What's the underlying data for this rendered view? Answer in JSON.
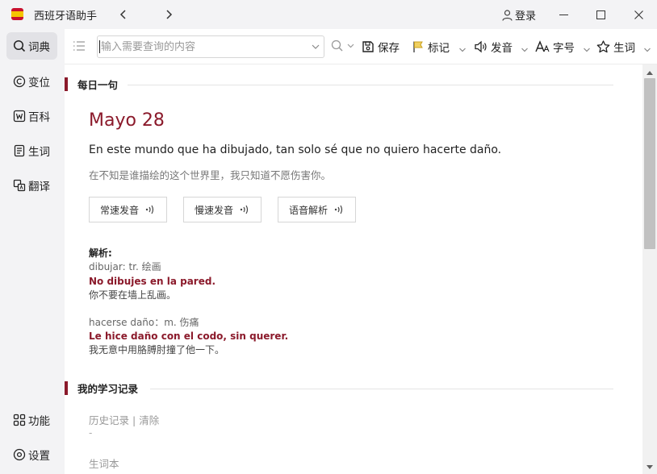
{
  "app": {
    "title": "西班牙语助手",
    "login_label": "登录",
    "icons": [
      "spain-flag-icon",
      "chevron-left-icon",
      "chevron-right-icon",
      "user-icon",
      "minimize-icon",
      "maximize-icon",
      "close-icon"
    ]
  },
  "sidebar": {
    "top_items": [
      {
        "label": "词典",
        "icon": "search-icon",
        "active": true
      },
      {
        "label": "变位",
        "icon": "copyright-icon"
      },
      {
        "label": "百科",
        "icon": "wiki-icon"
      },
      {
        "label": "生词",
        "icon": "notebook-icon"
      },
      {
        "label": "翻译",
        "icon": "translate-icon"
      }
    ],
    "bottom_items": [
      {
        "label": "功能",
        "icon": "grid-icon"
      },
      {
        "label": "设置",
        "icon": "settings-icon"
      }
    ]
  },
  "toolbar": {
    "search_placeholder": "输入需要查询的内容",
    "save_label": "保存",
    "mark_label": "标记",
    "speak_label": "发音",
    "font_label": "字号",
    "vocab_label": "生词"
  },
  "daily": {
    "section_title": "每日一句",
    "date": "Mayo 28",
    "sentence_es": "En este mundo que ha dibujado, tan solo sé que no quiero hacerte daño.",
    "sentence_zh": "在不知是谁描绘的这个世界里，我只知道不愿伤害你。",
    "buttons": [
      "常速发音",
      "慢速发音",
      "语音解析"
    ],
    "analysis_label": "解析:",
    "notes": [
      {
        "term": "dibujar: tr. 绘画",
        "example_es": "No dibujes en la pared.",
        "example_zh": "你不要在墙上乱画。"
      },
      {
        "term": "hacerse daño：m. 伤痛",
        "example_es": "Le hice daño con el codo, sin querer.",
        "example_zh": "我无意中用胳膊肘撞了他一下。"
      }
    ]
  },
  "history": {
    "section_title": "我的学习记录",
    "history_link": "历史记录",
    "separator": "|",
    "clear_link": "清除",
    "empty": "-",
    "vocab_label": "生词本"
  },
  "colors": {
    "accent": "#8b1a2b",
    "sidebar_bg": "#f3f3f5",
    "active_item": "#e2e2e6"
  }
}
